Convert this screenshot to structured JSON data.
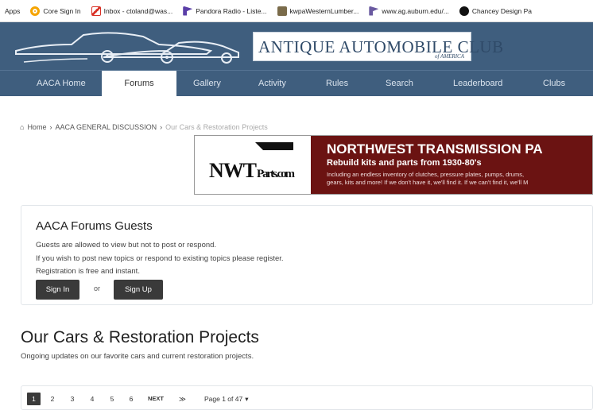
{
  "bookmarks": [
    {
      "label": "Apps",
      "icon": ""
    },
    {
      "label": "Core Sign In",
      "icon": "core-icon"
    },
    {
      "label": "Inbox - ctoland@was...",
      "icon": "gmail-icon"
    },
    {
      "label": "Pandora Radio - Liste...",
      "icon": "pandora-icon"
    },
    {
      "label": "kwpaWesternLumber...",
      "icon": "lumber-icon"
    },
    {
      "label": "www.ag.auburn.edu/...",
      "icon": "auburn-icon"
    },
    {
      "label": "Chancey Design Pa",
      "icon": "chancey-icon"
    }
  ],
  "site": {
    "logo_text": "ANTIQUE AUTOMOBILE CLUB",
    "logo_sub": "of AMERICA"
  },
  "nav": {
    "items": [
      "AACA Home",
      "Forums",
      "Gallery",
      "Activity",
      "Rules",
      "Search",
      "Leaderboard",
      "Clubs"
    ],
    "active": "Forums"
  },
  "breadcrumb": {
    "home": "Home",
    "forum": "AACA GENERAL DISCUSSION",
    "current": "Our Cars & Restoration Projects",
    "separator": "›"
  },
  "banner": {
    "logo_text": "NWTParts.com",
    "headline": "NORTHWEST TRANSMISSION PA",
    "subheadline": "Rebuild kits and parts from 1930-80's",
    "body_line1": "Including an endless inventory of clutches, pressure plates, pumps, drums,",
    "body_line2": "gears, kits and more! If we don't have it, we'll find it. If we can't find it, we'll M"
  },
  "guests": {
    "title": "AACA Forums Guests",
    "line1": "Guests are allowed to view but not to post or respond.",
    "line2": "If you wish to post new topics or respond to existing topics please register.",
    "line3": "Registration is free and instant.",
    "sign_in": "Sign In",
    "or": "or",
    "sign_up": "Sign Up"
  },
  "section": {
    "title": "Our Cars & Restoration Projects",
    "description": "Ongoing updates on our favorite cars and current restoration projects."
  },
  "pagination": {
    "pages": [
      "1",
      "2",
      "3",
      "4",
      "5",
      "6"
    ],
    "current": "1",
    "next": "NEXT",
    "last": "≫",
    "page_of": "Page 1 of 47",
    "caret": "▾"
  },
  "colors": {
    "header_bg": "#3f5e7e",
    "banner_red": "#6b1312",
    "button_dark": "#3a3a3a"
  }
}
